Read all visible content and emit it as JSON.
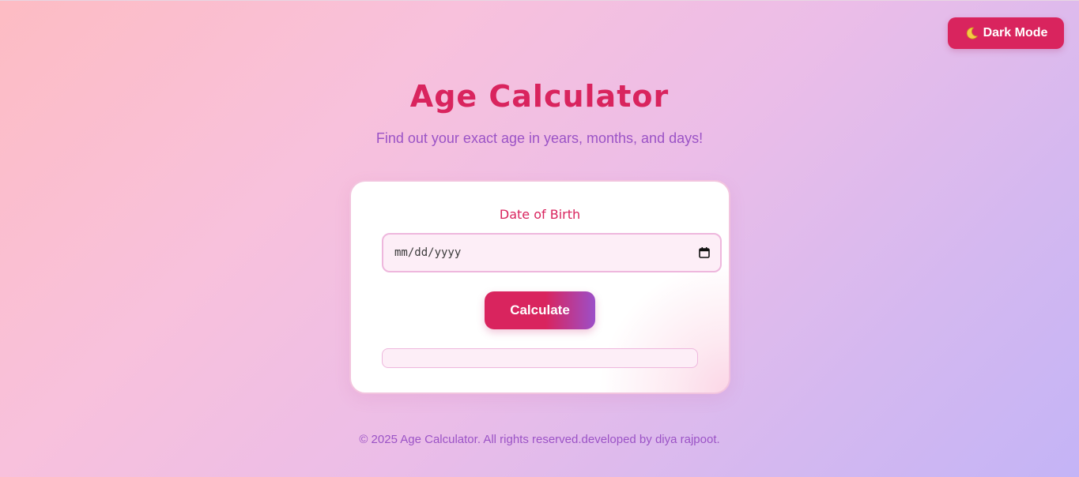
{
  "header": {
    "dark_mode_label": "Dark Mode",
    "dark_mode_icon": "moon-icon"
  },
  "main": {
    "title": "Age Calculator",
    "subtitle": "Find out your exact age in years, months, and days!"
  },
  "form": {
    "dob_label": "Date of Birth",
    "date_placeholder": "mm/dd/yyyy",
    "date_value": "",
    "calendar_icon": "calendar-icon",
    "calculate_label": "Calculate",
    "result_text": ""
  },
  "footer": {
    "text": "© 2025 Age Calculator. All rights reserved.developed by diya rajpoot."
  },
  "colors": {
    "accent": "#d9245e",
    "secondary": "#9b53c6",
    "card_bg": "#ffffff",
    "input_bg": "#fdeef7"
  }
}
